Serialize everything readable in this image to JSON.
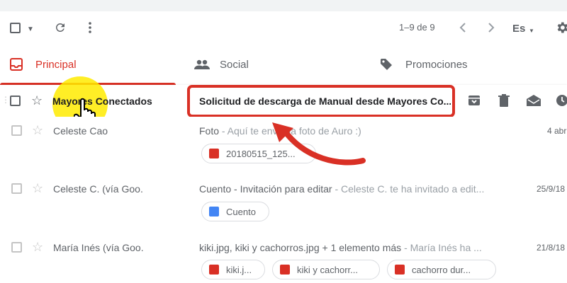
{
  "toolbar": {
    "select_icon": "checkbox-dropdown",
    "refresh_icon": "refresh-icon",
    "more_icon": "more-vert-icon",
    "page_count": "1–9 de 9",
    "language": "Es",
    "settings_icon": "gear-icon"
  },
  "tabs": [
    {
      "label": "Principal",
      "icon": "inbox-icon",
      "active": true
    },
    {
      "label": "Social",
      "icon": "people-icon",
      "active": false
    },
    {
      "label": "Promociones",
      "icon": "tag-icon",
      "active": false
    }
  ],
  "emails": [
    {
      "sender": "Mayores Conectados",
      "subject": "Solicitud de descarga de Manual desde Mayores Co...",
      "snippet": "",
      "date": "",
      "unread": true,
      "attachments": []
    },
    {
      "sender": "Celeste Cao",
      "subject": "Foto",
      "snippet": " - Aquí te envío la foto de Auro :)",
      "date": "4 abr",
      "unread": false,
      "attachments": [
        {
          "name": "20180515_125...",
          "type": "image"
        }
      ]
    },
    {
      "sender": "Celeste C. (vía Goo.",
      "subject": "Cuento - Invitación para editar",
      "snippet": " - Celeste C. te ha invitado a edit...",
      "date": "25/9/18",
      "unread": false,
      "attachments": [
        {
          "name": "Cuento",
          "type": "doc"
        }
      ]
    },
    {
      "sender": "María Inés (vía Goo.",
      "subject": "kiki.jpg, kiki y cachorros.jpg + 1 elemento más",
      "snippet": " - María Inés ha ...",
      "date": "21/8/18",
      "unread": false,
      "attachments": [
        {
          "name": "kiki.j...",
          "type": "image"
        },
        {
          "name": "kiki y cachorr...",
          "type": "image"
        },
        {
          "name": "cachorro dur...",
          "type": "image"
        }
      ]
    }
  ],
  "row_actions": [
    "archive-icon",
    "delete-icon",
    "mark-read-icon",
    "snooze-icon"
  ],
  "colors": {
    "accent": "#d93025",
    "highlight": "#ffeb00"
  }
}
